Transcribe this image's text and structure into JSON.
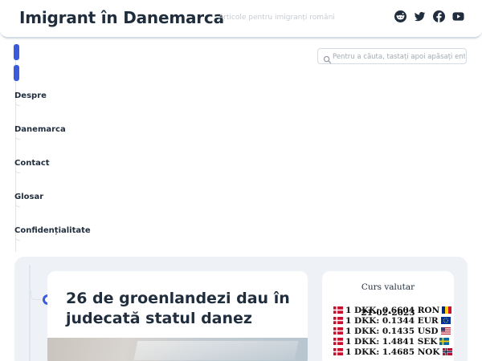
{
  "header": {
    "site_title": "Imigrant în Danemarca",
    "tagline": "Articole pentru imigranți români",
    "social_icons": [
      "reddit-icon",
      "twitter-icon",
      "facebook-icon",
      "youtube-icon"
    ]
  },
  "nav": {
    "items": [
      {
        "label": "Despre"
      },
      {
        "label": "Danemarca"
      },
      {
        "label": "Contact"
      },
      {
        "label": "Glosar"
      },
      {
        "label": "Confidențialitate"
      }
    ]
  },
  "search": {
    "placeholder": "Pentru a căuta, tastați apoi apăsați enter",
    "value": ""
  },
  "article": {
    "title": "26 de groenlandezi dau în judecată statul danez"
  },
  "fx": {
    "title": "Curs valutar",
    "date": "21-02-2023",
    "rates": [
      {
        "text": "1 DKK: 0.6604 RON",
        "currency": "RON"
      },
      {
        "text": "1 DKK: 0.1344 EUR",
        "currency": "EUR"
      },
      {
        "text": "1 DKK: 0.1435 USD",
        "currency": "USD"
      },
      {
        "text": "1 DKK: 1.4841 SEK",
        "currency": "SEK"
      },
      {
        "text": "1 DKK: 1.4685 NOK",
        "currency": "NOK"
      }
    ]
  },
  "colors": {
    "accent": "#3b5bdb",
    "text": "#1f2d3d",
    "panel_bg": "#eef1f6"
  }
}
